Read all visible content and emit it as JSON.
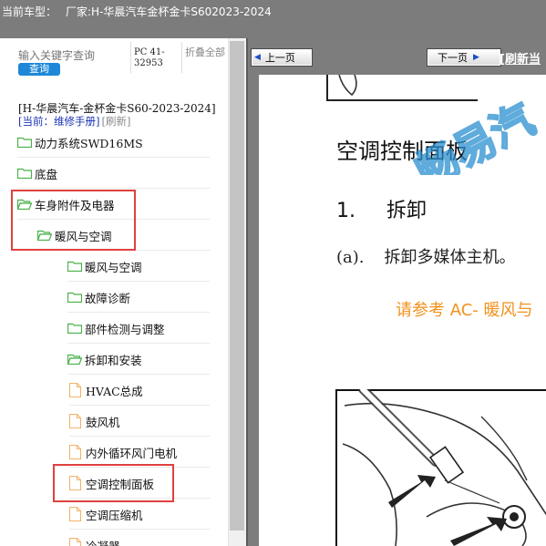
{
  "titlebar": {
    "model_label": "当前车型：",
    "vendor_label": "厂家:H-华晨汽车金杯金卡S602023-2024"
  },
  "left_panel": {
    "search_placeholder": "输入关键字查询",
    "search_button": "查询",
    "pc_code": "PC 41-32953",
    "collapse_all": "折叠全部",
    "doc_title": "[H-华晨汽车-金杯金卡S60-2023-2024]",
    "current_label": "[当前：维修手册]",
    "refresh_label": "[刷新]",
    "tree": [
      {
        "label": "动力系统SWD16MS",
        "icon": "folder-icon"
      },
      {
        "label": "底盘",
        "icon": "folder-icon"
      },
      {
        "label": "车身附件及电器",
        "icon": "folder-open-icon"
      },
      {
        "label": "暖风与空调",
        "icon": "folder-open-icon"
      },
      {
        "label": "暖风与空调",
        "icon": "folder-icon"
      },
      {
        "label": "故障诊断",
        "icon": "folder-icon"
      },
      {
        "label": "部件检测与调整",
        "icon": "folder-icon"
      },
      {
        "label": "拆卸和安装",
        "icon": "folder-open-icon"
      },
      {
        "label": "HVAC总成",
        "icon": "file-icon"
      },
      {
        "label": "鼓风机",
        "icon": "file-icon"
      },
      {
        "label": "内外循环风门电机",
        "icon": "file-icon"
      },
      {
        "label": "空调控制面板",
        "icon": "file-icon"
      },
      {
        "label": "空调压缩机",
        "icon": "file-icon"
      },
      {
        "label": "冷凝器",
        "icon": "file-icon"
      }
    ]
  },
  "viewer": {
    "prev_button": "上一页",
    "next_button": "下一页",
    "refresh_page": "[刷新当",
    "page": {
      "section_title": "空调控制面板",
      "step_number": "1.",
      "step_label": "拆卸",
      "substep_number": "(a).",
      "substep_label": "拆卸多媒体主机。",
      "reference": "请参考 AC- 暖风与",
      "watermark": "畅易汽"
    }
  },
  "colors": {
    "titlebar_bg": "#7c7c7c",
    "accent_blue": "#1e88d8",
    "highlight_red": "#e0403f",
    "folder_green": "#48b048",
    "file_orange": "#f3b26a",
    "reference_orange": "#f2921c",
    "watermark_blue": "#2a8fd0"
  }
}
